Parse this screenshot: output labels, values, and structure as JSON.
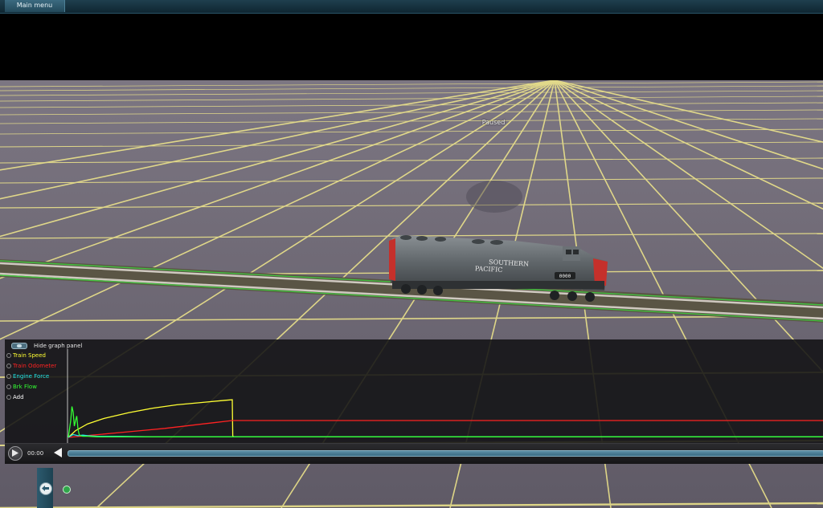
{
  "topbar": {
    "main_menu_label": "Main menu"
  },
  "viewport": {
    "status_text": "Paused",
    "locomotive_text": [
      "SOUTHERN",
      "PACIFIC"
    ],
    "locomotive_number": "0000"
  },
  "graph_panel": {
    "hide_label": "Hide graph panel",
    "legend": [
      {
        "label": "Train Speed",
        "color": "#ffff33"
      },
      {
        "label": "Train Odometer",
        "color": "#ff2222"
      },
      {
        "label": "Engine Force",
        "color": "#22e6e6"
      },
      {
        "label": "Brk Flow",
        "color": "#33ff33"
      },
      {
        "label": "Add",
        "color": "#ffffff"
      }
    ]
  },
  "timeline": {
    "time": "00:00",
    "position": 0
  },
  "icons": {
    "play": "play-icon",
    "back": "back-arrow-icon",
    "hide_graph": "toggle-icon"
  },
  "chart_data": {
    "type": "line",
    "title": "",
    "xlabel": "",
    "ylabel": "",
    "grid": false,
    "xlim": [
      0,
      100
    ],
    "ylim": [
      0,
      100
    ],
    "series": [
      {
        "name": "Train Speed",
        "color": "#ffff33",
        "x": [
          0,
          3,
          8,
          15,
          25,
          35,
          45,
          55,
          65,
          68,
          68.2,
          68.5
        ],
        "y": [
          0,
          12,
          24,
          34,
          44,
          52,
          58,
          62,
          66,
          67,
          3,
          1
        ]
      },
      {
        "name": "Train Odometer",
        "color": "#ff2222",
        "x": [
          0,
          10,
          20,
          30,
          40,
          50,
          60,
          68,
          80,
          100
        ],
        "y": [
          0,
          4,
          8,
          12,
          16,
          21,
          26,
          30,
          30,
          30
        ]
      },
      {
        "name": "Engine Force",
        "color": "#22e6e6",
        "x": [
          0,
          2,
          4,
          6,
          8,
          12,
          20,
          35,
          50,
          68
        ],
        "y": [
          0,
          5,
          3,
          4,
          3,
          2,
          2,
          1,
          1,
          1
        ]
      },
      {
        "name": "Brk Flow",
        "color": "#33ff33",
        "x": [
          0,
          1,
          1.5,
          2,
          2.5,
          3,
          3.5,
          4,
          4.5,
          5,
          6,
          8,
          12,
          20,
          40,
          100
        ],
        "y": [
          0,
          30,
          55,
          45,
          20,
          30,
          38,
          15,
          5,
          3,
          2,
          2,
          1,
          1,
          1,
          1
        ]
      }
    ]
  }
}
